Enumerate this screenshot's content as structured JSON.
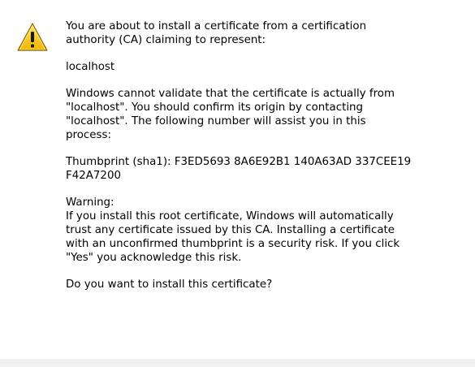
{
  "dialog": {
    "intro": {
      "line1": "You are about to install a certificate from a certification",
      "line2": "authority (CA) claiming to represent:"
    },
    "host": "localhost",
    "validation": {
      "line1": "Windows cannot validate that the certificate is actually from",
      "line2": "\"localhost\". You should confirm its origin by contacting",
      "line3": "\"localhost\". The following number will assist you in this",
      "line4": "process:"
    },
    "thumbprint": {
      "line1": "Thumbprint (sha1): F3ED5693 8A6E92B1 140A63AD 337CEE19",
      "line2": "F42A7200"
    },
    "warning": {
      "heading": "Warning:",
      "line1": "If you install this root certificate, Windows will automatically",
      "line2": "trust any certificate issued by this CA. Installing a certificate",
      "line3": "with an unconfirmed thumbprint is a security risk. If you click",
      "line4": "\"Yes\" you acknowledge this risk."
    },
    "question": "Do you want to install this certificate?",
    "icon": "warning-triangle-icon"
  }
}
